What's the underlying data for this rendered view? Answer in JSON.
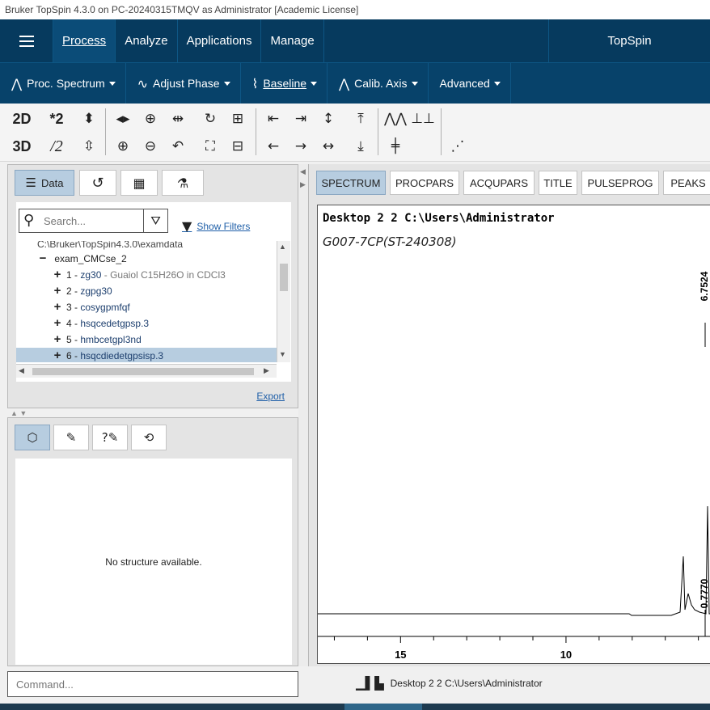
{
  "window": {
    "title": "Bruker TopSpin 4.3.0 on PC-20240315TMQV as Administrator [Academic License]"
  },
  "menubar": {
    "items": [
      "Process",
      "Analyze",
      "Applications",
      "Manage"
    ],
    "brand": "TopSpin"
  },
  "toolbar1": {
    "items": [
      {
        "label": "Proc. Spectrum",
        "icon": "peak-icon"
      },
      {
        "label": "Adjust Phase",
        "icon": "phase-icon"
      },
      {
        "label": "Baseline",
        "icon": "baseline-icon"
      },
      {
        "label": "Calib. Axis",
        "icon": "calib-icon"
      },
      {
        "label": "Advanced"
      }
    ]
  },
  "toolbar2": {
    "mode_2d": "2D",
    "mode_3d": "3D",
    "mult2": "*2",
    "div2": "/2"
  },
  "data_panel": {
    "tabs": [
      {
        "label": "Data",
        "icon": "list-icon"
      },
      {
        "label": "",
        "icon": "history-icon"
      },
      {
        "label": "",
        "icon": "layout-icon"
      },
      {
        "label": "",
        "icon": "flask-icon"
      }
    ],
    "search": {
      "placeholder": "Search..."
    },
    "show_filters": "Show Filters",
    "tree": {
      "path": "C:\\Bruker\\TopSpin4.3.0\\examdata",
      "dataset": "exam_CMCse_2",
      "items": [
        {
          "num": "1",
          "name": "zg30",
          "desc": "Guaiol C15H26O in CDCl3"
        },
        {
          "num": "2",
          "name": "zgpg30",
          "desc": ""
        },
        {
          "num": "3",
          "name": "cosygpmfqf",
          "desc": ""
        },
        {
          "num": "4",
          "name": "hsqcedetgpsp.3",
          "desc": ""
        },
        {
          "num": "5",
          "name": "hmbcetgpl3nd",
          "desc": ""
        },
        {
          "num": "6",
          "name": "hsqcdiedetgpsisp.3",
          "desc": ""
        }
      ],
      "selected_index": 5
    },
    "export": "Export"
  },
  "structure_panel": {
    "tabs": [
      "structure-icon",
      "edit-history-icon",
      "help-edit-icon",
      "comment-history-icon"
    ],
    "message": "No structure available."
  },
  "spectrum_tabs": [
    "SPECTRUM",
    "PROCPARS",
    "ACQUPARS",
    "TITLE",
    "PULSEPROG",
    "PEAKS"
  ],
  "spectrum": {
    "header": "Desktop  2  2  C:\\Users\\Administrator",
    "subtitle": "G007-7CP(ST-240308)",
    "peak_labels": [
      "6.7524",
      "0.7770"
    ],
    "x_ticks": [
      "15",
      "10"
    ]
  },
  "chart_data": {
    "type": "line",
    "title": "Desktop  2  2  C:\\Users\\Administrator",
    "subtitle": "G007-7CP(ST-240308)",
    "xlabel": "",
    "ylabel": "",
    "xlim": [
      17.5,
      5.6
    ],
    "x_ticks": [
      15,
      10
    ],
    "peaks": [
      {
        "ppm": 6.7524,
        "label": "6.7524"
      },
      {
        "ppm": 0.777,
        "label": "0.7770"
      }
    ],
    "grid": false
  },
  "command": {
    "placeholder": "Command..."
  },
  "status": {
    "text": "Desktop  2  2  C:\\Users\\Administrator"
  }
}
